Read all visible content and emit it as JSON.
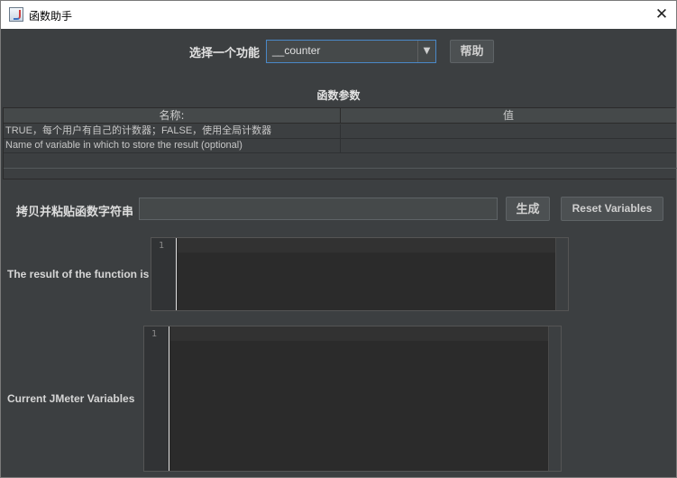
{
  "window": {
    "title": "函数助手",
    "close_glyph": "✕",
    "icon": "java-cup-icon"
  },
  "function_selector": {
    "label": "选择一个功能",
    "selected": "__counter",
    "arrow_glyph": "▼"
  },
  "help_button": "帮助",
  "parameters": {
    "title": "函数参数",
    "columns": [
      "名称:",
      "值"
    ],
    "rows": [
      {
        "name": "TRUE，每个用户有自己的计数器；FALSE，使用全局计数器",
        "value": ""
      },
      {
        "name": "Name of variable in which to store the result (optional)",
        "value": ""
      }
    ]
  },
  "copy_string": {
    "label": "拷贝并粘贴函数字符串",
    "value": ""
  },
  "generate_button": "生成",
  "reset_button": "Reset Variables",
  "result": {
    "label": "The result of the function is",
    "line_number": "1"
  },
  "variables": {
    "label": "Current JMeter Variables",
    "line_number": "1"
  }
}
